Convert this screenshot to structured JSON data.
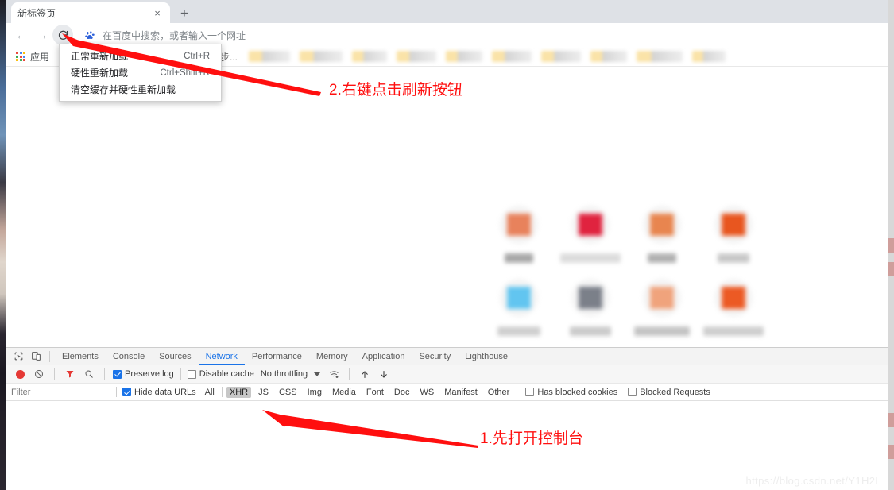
{
  "browser": {
    "tab": {
      "title": "新标签页",
      "close_label": "×"
    },
    "new_tab_button": "+",
    "nav": {
      "back": "←",
      "forward": "→",
      "reload": "⟳"
    },
    "omnibox": {
      "placeholder": "在百度中搜索，或者输入一个网址",
      "icon": "baidu-paw-icon"
    },
    "bookmarks": {
      "apps_label": "应用",
      "blurred_item": "搜步...",
      "blurred_widths": [
        52,
        54,
        44,
        50,
        46,
        50,
        50,
        46,
        58,
        42
      ]
    }
  },
  "context_menu": {
    "items": [
      {
        "label": "正常重新加载",
        "accel": "Ctrl+R"
      },
      {
        "label": "硬性重新加载",
        "accel": "Ctrl+Shift+R"
      },
      {
        "label": "清空缓存并硬性重新加载",
        "accel": ""
      }
    ]
  },
  "new_tab_page": {
    "tiles": [
      {
        "glyph_color": "#e8825c",
        "label_width": 36,
        "label_color": "#a8a8a8"
      },
      {
        "glyph_color": "#e0233f",
        "label_width": 76,
        "label_color": "#dcdcdc"
      },
      {
        "glyph_color": "#e8854f",
        "label_width": 36,
        "label_color": "#b0b0b0"
      },
      {
        "glyph_color": "#e8561f",
        "label_width": 40,
        "label_color": "#c8c8c8"
      },
      {
        "glyph_color": "#62c5f0",
        "label_width": 54,
        "label_color": "#d0d0d0"
      },
      {
        "glyph_color": "#7b8089",
        "label_width": 52,
        "label_color": "#cccccc"
      },
      {
        "glyph_color": "#f0a37c",
        "label_width": 70,
        "label_color": "#c4c4c4"
      },
      {
        "glyph_color": "#ec5a24",
        "label_width": 76,
        "label_color": "#cfcfcf"
      }
    ]
  },
  "devtools": {
    "inspect_icon": "inspect-element-icon",
    "device_icon": "device-toolbar-icon",
    "tabs": [
      {
        "label": "Elements",
        "active": false
      },
      {
        "label": "Console",
        "active": false
      },
      {
        "label": "Sources",
        "active": false
      },
      {
        "label": "Network",
        "active": true
      },
      {
        "label": "Performance",
        "active": false
      },
      {
        "label": "Memory",
        "active": false
      },
      {
        "label": "Application",
        "active": false
      },
      {
        "label": "Security",
        "active": false
      },
      {
        "label": "Lighthouse",
        "active": false
      }
    ],
    "toolbar": {
      "record_icon": "record-button-icon",
      "clear_icon": "clear-icon",
      "filter_icon": "filter-funnel-icon",
      "search_icon": "search-icon",
      "preserve_log": {
        "label": "Preserve log",
        "checked": true
      },
      "disable_cache": {
        "label": "Disable cache",
        "checked": false
      },
      "throttling": "No throttling",
      "network_conditions_icon": "wifi-settings-icon",
      "import_icon": "import-har-icon",
      "export_icon": "export-har-icon"
    },
    "filterbar": {
      "filter_placeholder": "Filter",
      "filter_value": "",
      "hide_data_urls": {
        "label": "Hide data URLs",
        "checked": true
      },
      "types": [
        {
          "label": "All",
          "active": false
        },
        {
          "label": "XHR",
          "active": true
        },
        {
          "label": "JS",
          "active": false
        },
        {
          "label": "CSS",
          "active": false
        },
        {
          "label": "Img",
          "active": false
        },
        {
          "label": "Media",
          "active": false
        },
        {
          "label": "Font",
          "active": false
        },
        {
          "label": "Doc",
          "active": false
        },
        {
          "label": "WS",
          "active": false
        },
        {
          "label": "Manifest",
          "active": false
        },
        {
          "label": "Other",
          "active": false
        }
      ],
      "has_blocked_cookies": {
        "label": "Has blocked cookies",
        "checked": false
      },
      "blocked_requests": {
        "label": "Blocked Requests",
        "checked": false
      }
    }
  },
  "annotations": {
    "step2": "2.右键点击刷新按钮",
    "step1": "1.先打开控制台",
    "arrow_color": "#ff0f0f"
  },
  "watermark": "https://blog.csdn.net/Y1H2L"
}
